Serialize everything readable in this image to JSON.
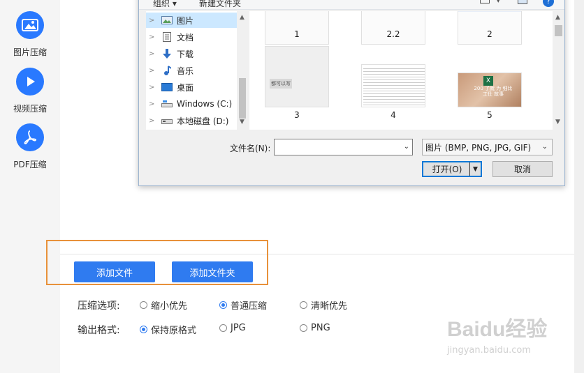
{
  "sidebar": {
    "items": [
      {
        "label": "图片压缩",
        "icon": "image-icon"
      },
      {
        "label": "视频压缩",
        "icon": "play-icon"
      },
      {
        "label": "PDF压缩",
        "icon": "pdf-icon"
      }
    ]
  },
  "actions": {
    "add_file": "添加文件",
    "add_folder": "添加文件夹"
  },
  "options": {
    "compress_label": "压缩选项:",
    "compress": [
      {
        "label": "缩小优先",
        "checked": false
      },
      {
        "label": "普通压缩",
        "checked": true
      },
      {
        "label": "清晰优先",
        "checked": false
      }
    ],
    "format_label": "输出格式:",
    "format": [
      {
        "label": "保持原格式",
        "checked": true
      },
      {
        "label": "JPG",
        "checked": false
      },
      {
        "label": "PNG",
        "checked": false
      }
    ]
  },
  "dialog": {
    "toolbar": {
      "organize": "组织 ▾",
      "new_folder": "新建文件夹"
    },
    "nav": [
      {
        "label": "图片",
        "icon": "pictures-icon",
        "selected": true
      },
      {
        "label": "文档",
        "icon": "documents-icon",
        "selected": false
      },
      {
        "label": "下载",
        "icon": "download-icon",
        "selected": false
      },
      {
        "label": "音乐",
        "icon": "music-icon",
        "selected": false
      },
      {
        "label": "桌面",
        "icon": "desktop-icon",
        "selected": false
      },
      {
        "label": "Windows (C:)",
        "icon": "drive-icon",
        "selected": false
      },
      {
        "label": "本地磁盘 (D:)",
        "icon": "drive-icon",
        "selected": false
      }
    ],
    "files": [
      {
        "name": "1"
      },
      {
        "name": "2.2"
      },
      {
        "name": "2"
      },
      {
        "name": "3",
        "thumb_text": "都可以写"
      },
      {
        "name": "4"
      },
      {
        "name": "5",
        "thumb_text": "200 了就 为 细比工仕 故事"
      }
    ],
    "filename_label": "文件名(N):",
    "filename_value": "",
    "filetype": "图片 (BMP, PNG, JPG, GIF)",
    "open_button": "打开(O)",
    "cancel_button": "取消"
  },
  "watermark": {
    "brand": "Baidu经验",
    "url": "jingyan.baidu.com"
  },
  "colors": {
    "accent": "#2f7bf0",
    "highlight": "#e8913a",
    "sidebar_icon": "#2979ff"
  }
}
